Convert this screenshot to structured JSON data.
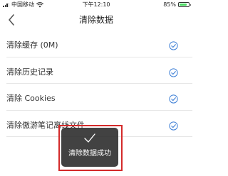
{
  "status_bar": {
    "carrier": "中国移动",
    "time": "下午12:10",
    "battery": "85%",
    "battery_level": 0.85
  },
  "nav": {
    "title": "清除数据",
    "back_icon": "chevron-left-icon"
  },
  "list": {
    "items": [
      {
        "label": "清除缓存 (0M)",
        "checked": true
      },
      {
        "label": "清除历史记录",
        "checked": true
      },
      {
        "label": "清除 Cookies",
        "checked": true
      },
      {
        "label": "清除傲游笔记离线文件",
        "checked": true
      }
    ]
  },
  "toast": {
    "text": "清除数据成功",
    "icon": "checkmark-icon"
  },
  "colors": {
    "accent": "#3d7fd6",
    "highlight": "#d42a2a",
    "battery_green": "#4cd964"
  }
}
